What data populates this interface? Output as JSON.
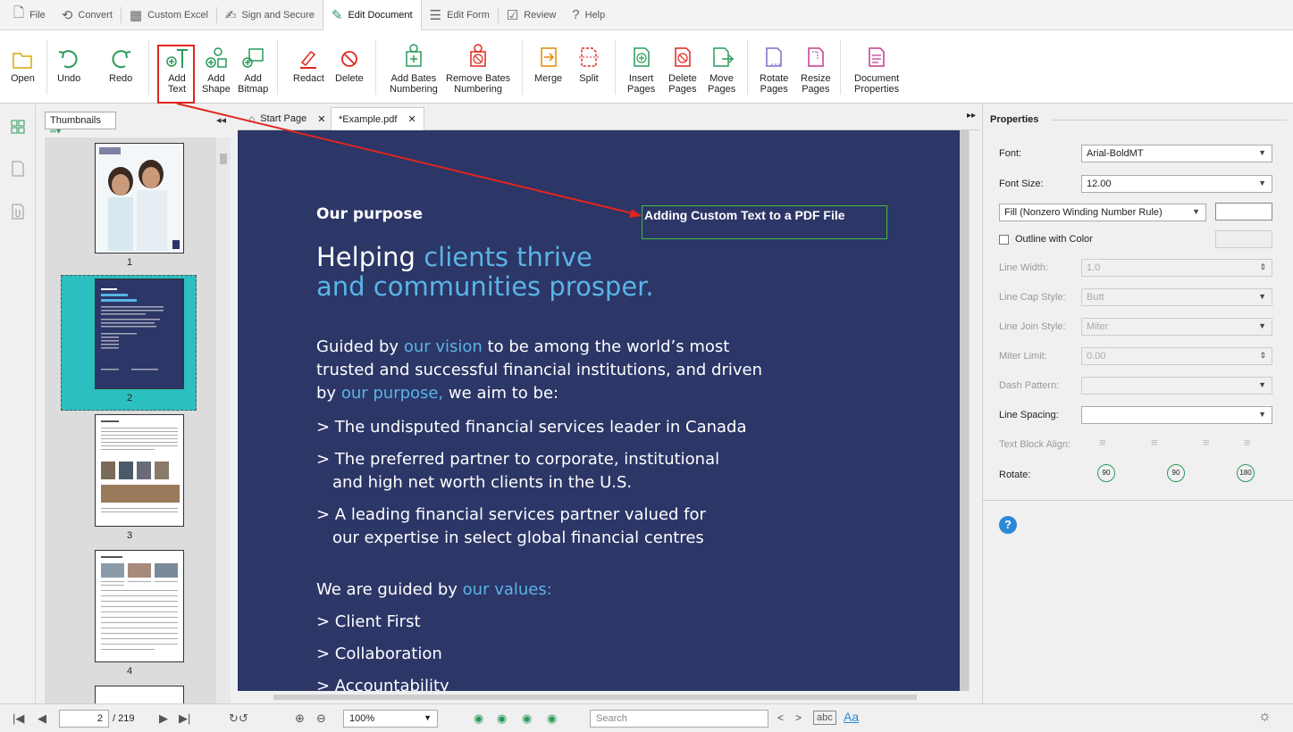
{
  "menu": {
    "file": "File",
    "convert": "Convert",
    "custom_excel": "Custom Excel",
    "sign_secure": "Sign and Secure",
    "edit_document": "Edit Document",
    "edit_form": "Edit Form",
    "review": "Review",
    "help": "Help"
  },
  "ribbon": {
    "open": "Open",
    "undo": "Undo",
    "redo": "Redo",
    "add_text_1": "Add",
    "add_text_2": "Text",
    "add_shape_1": "Add",
    "add_shape_2": "Shape",
    "add_bitmap_1": "Add",
    "add_bitmap_2": "Bitmap",
    "redact": "Redact",
    "delete": "Delete",
    "add_bates_1": "Add Bates",
    "add_bates_2": "Numbering",
    "remove_bates_1": "Remove Bates",
    "remove_bates_2": "Numbering",
    "merge": "Merge",
    "split": "Split",
    "insert_pages_1": "Insert",
    "insert_pages_2": "Pages",
    "delete_pages_1": "Delete",
    "delete_pages_2": "Pages",
    "move_pages_1": "Move",
    "move_pages_2": "Pages",
    "rotate_pages_1": "Rotate",
    "rotate_pages_2": "Pages",
    "resize_pages_1": "Resize",
    "resize_pages_2": "Pages",
    "doc_props_1": "Document",
    "doc_props_2": "Properties"
  },
  "thumbnails": {
    "dropdown": "Thumbnails",
    "pages": [
      "1",
      "2",
      "3",
      "4"
    ]
  },
  "tabs": {
    "start_page": "Start Page",
    "example": "*Example.pdf"
  },
  "page": {
    "heading": "Our purpose",
    "custom_text": "Adding Custom Text to a PDF File",
    "title_1a": "Helping ",
    "title_1b": "clients thrive",
    "title_2": "and communities prosper.",
    "para_1a": "Guided by ",
    "para_1b": "our vision",
    "para_1c": " to be among the world’s most",
    "para_2": "trusted and successful financial institutions, and driven",
    "para_3a": "by ",
    "para_3b": "our purpose,",
    "para_3c": " we aim to be:",
    "bullet_1": "> The undisputed financial services leader in Canada",
    "bullet_2a": "> The preferred partner to corporate, institutional",
    "bullet_2b": "and high net worth clients in the U.S.",
    "bullet_3a": "> A leading financial services partner valued for",
    "bullet_3b": "our expertise in select global financial centres",
    "values_a": "We are guided by ",
    "values_b": "our values:",
    "v1": "> Client First",
    "v2": "> Collaboration",
    "v3": "> Accountability"
  },
  "properties": {
    "title": "Properties",
    "font_label": "Font:",
    "font_value": "Arial-BoldMT",
    "font_size_label": "Font Size:",
    "font_size_value": "12.00",
    "fill_value": "Fill (Nonzero Winding Number Rule)",
    "outline_label": "Outline with Color",
    "line_width_label": "Line Width:",
    "line_width_value": "1.0",
    "line_cap_label": "Line Cap Style:",
    "line_cap_value": "Butt",
    "line_join_label": "Line Join Style:",
    "line_join_value": "Miter",
    "miter_label": "Miter Limit:",
    "miter_value": "0.00",
    "dash_label": "Dash Pattern:",
    "line_spacing_label": "Line Spacing:",
    "text_align_label": "Text Block Align:",
    "rotate_label": "Rotate:",
    "rot_1": "90",
    "rot_2": "90",
    "rot_3": "180"
  },
  "status": {
    "page_current": "2",
    "page_total": "/ 219",
    "zoom": "100%",
    "search_placeholder": "Search",
    "abc": "abc",
    "aa": "Aa"
  },
  "colors": {
    "page_bg": "#2c3667",
    "accent_blue": "#5ab4e6",
    "highlight_red": "#e0261f",
    "thumb_selected": "#2bbfbf"
  }
}
